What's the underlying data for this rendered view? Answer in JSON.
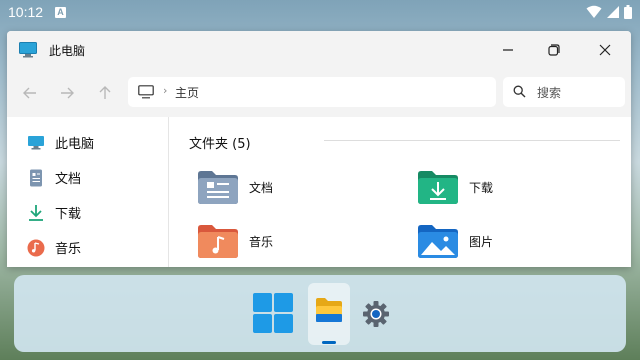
{
  "status_bar": {
    "time": "10:12",
    "notification_badge": "A"
  },
  "window": {
    "title": "此电脑",
    "address": {
      "crumb": "主页"
    },
    "search": {
      "placeholder": "搜索"
    }
  },
  "sidebar": {
    "items": [
      {
        "label": "此电脑",
        "icon": "computer-icon"
      },
      {
        "label": "文档",
        "icon": "document-icon"
      },
      {
        "label": "下载",
        "icon": "download-icon"
      },
      {
        "label": "音乐",
        "icon": "music-icon"
      }
    ]
  },
  "main": {
    "heading": "文件夹 (5)",
    "folders": [
      {
        "label": "文档",
        "icon": "documents-folder-icon"
      },
      {
        "label": "下载",
        "icon": "downloads-folder-icon"
      },
      {
        "label": "音乐",
        "icon": "music-folder-icon"
      },
      {
        "label": "图片",
        "icon": "pictures-folder-icon"
      }
    ]
  },
  "taskbar": {
    "items": [
      "start-icon",
      "file-explorer-icon",
      "settings-icon"
    ]
  },
  "colors": {
    "accent": "#0067c0",
    "folder_green": "#1fa67a",
    "folder_blue": "#1e7fd6",
    "folder_orange": "#ef7d4a"
  }
}
